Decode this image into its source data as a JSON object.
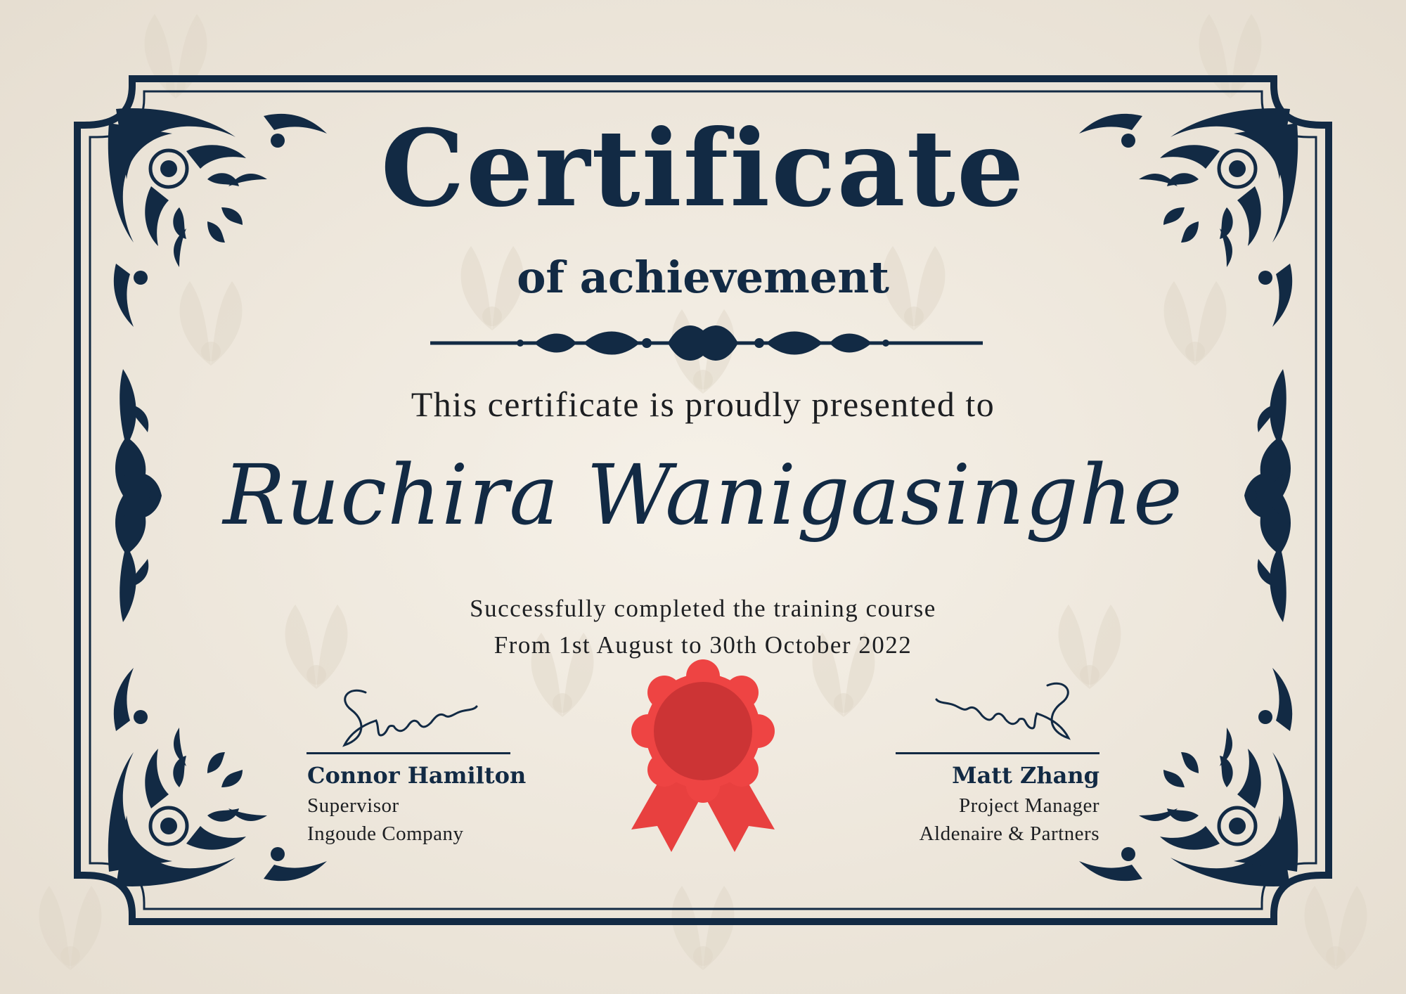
{
  "certificate": {
    "title": "Certificate",
    "subtitle": "of achievement",
    "presented_text": "This certificate is proudly presented to",
    "recipient": "Ruchira Wanigasinghe",
    "course_text": "Successfully completed the training course",
    "date_text": "From 1st August to 30th October 2022"
  },
  "signatories": {
    "left": {
      "name": "Connor Hamilton",
      "role": "Supervisor",
      "company": "Ingoude Company",
      "signature_text": "Signature"
    },
    "right": {
      "name": "Matt Zhang",
      "role": "Project Manager",
      "company": "Aldenaire & Partners",
      "signature_text": "Signature"
    }
  },
  "seal": {
    "icon": "ribbon-seal-icon",
    "color": "#e0393b"
  },
  "colors": {
    "frame": "#122a44",
    "paper": "#efe9df",
    "seal": "#e0393b"
  }
}
